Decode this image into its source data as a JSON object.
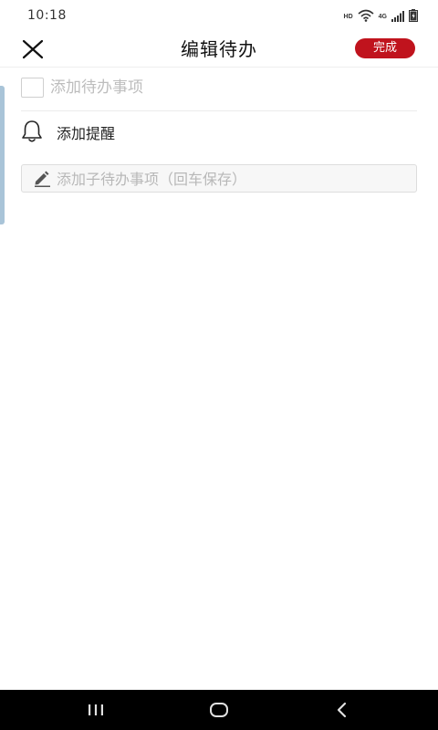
{
  "status_bar": {
    "time": "10:18",
    "hd": "HD",
    "network": "4G"
  },
  "header": {
    "title": "编辑待办",
    "done_label": "完成",
    "accent_color": "#c0131d"
  },
  "todo": {
    "placeholder": "添加待办事项",
    "value": ""
  },
  "reminder": {
    "label": "添加提醒"
  },
  "subtask": {
    "placeholder": "添加子待办事项（回车保存）",
    "value": ""
  },
  "icons": {
    "close": "close-icon",
    "bell": "bell-icon",
    "pencil": "pencil-icon",
    "wifi": "wifi-icon",
    "signal": "signal-icon",
    "battery": "battery-icon",
    "recents": "recents-icon",
    "home": "home-icon",
    "back": "back-icon"
  }
}
